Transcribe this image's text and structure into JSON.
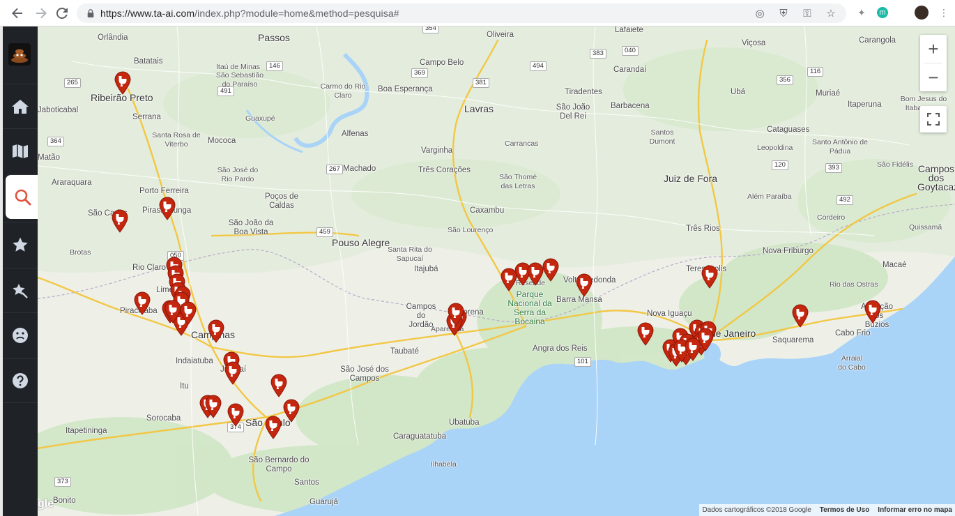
{
  "browser": {
    "url_host": "https://www.ta-ai.com",
    "url_path": "/index.php?module=home&method=pesquisa#",
    "extension_badge": "m"
  },
  "sidebar": {
    "items": [
      {
        "name": "home-icon"
      },
      {
        "name": "map-icon"
      },
      {
        "name": "search-icon"
      },
      {
        "name": "star-icon"
      },
      {
        "name": "pin-star-icon"
      },
      {
        "name": "sad-face-icon"
      },
      {
        "name": "help-icon"
      }
    ],
    "expand_label": "+"
  },
  "map": {
    "colors": {
      "land": "#eef0e8",
      "green": "#cde7c4",
      "water": "#a9d4f7",
      "road": "#f7d96a",
      "pin": "#c4260e"
    },
    "places": [
      "Orlândia",
      "Passos",
      "Lafaiete",
      "Oliveira",
      "Viçosa",
      "Carangola",
      "Batatais",
      "Itaú de Minas",
      "São Sebastião do Paraíso",
      "Campo Belo",
      "Carandaí",
      "Ribeirão Preto",
      "Carmo do Rio Claro",
      "Boa Esperança",
      "Tiradentes",
      "Ubá",
      "Muriaé",
      "Bom Jesus do Itabapoana",
      "Jaboticabal",
      "Serrana",
      "Lavras",
      "São João Del Rei",
      "Barbacena",
      "Itaperuna",
      "Guaxupé",
      "Santa Rosa de Viterbo",
      "Mococa",
      "Alfenas",
      "Carrancas",
      "Santos Dumont",
      "Cataguases",
      "Santo Antônio de Pádua",
      "Matão",
      "Varginha",
      "Leopoldina",
      "Araraquara",
      "Machado",
      "Três Corações",
      "São Thomé das Letras",
      "Juiz de Fora",
      "São Fidélis",
      "Campos dos Goytacazes",
      "São José do Rio Pardo",
      "Porto Ferreira",
      "Poços de Caldas",
      "Caxambu",
      "Além Paraíba",
      "Pirassununga",
      "São Carlos",
      "São João da Boa Vista",
      "Cordeiro",
      "Quissamã",
      "Três Rios",
      "São Lourenço",
      "Pouso Alegre",
      "Santa Rita do Sapucaí",
      "Nova Friburgo",
      "Brotas",
      "Rio Claro",
      "Itajubá",
      "Resende",
      "Volta Redonda",
      "Teresópolis",
      "Macaé",
      "Limeira",
      "Parque Nacional da Serra da Bocaina",
      "Barra Mansa",
      "Rio das Ostras",
      "Piracicaba",
      "Campos do Jordão",
      "Aparecida",
      "Lorena",
      "Armação dos Búzios",
      "Nova Iguaçu",
      "Campinas",
      "Rio de Janeiro",
      "Saquarema",
      "Cabo Frio",
      "Angra dos Reis",
      "Taubaté",
      "Indaiatuba",
      "Jundiaí",
      "Arraial do Cabo",
      "São José dos Campos",
      "Itu",
      "Sorocaba",
      "São Paulo",
      "Caraguatatuba",
      "Ubatuba",
      "Itapetininga",
      "Ilhabela",
      "São Bernardo do Campo",
      "Santos",
      "Bonito",
      "Guarujá"
    ],
    "highways": [
      "354",
      "383",
      "040",
      "116",
      "265",
      "491",
      "146",
      "369",
      "381",
      "494",
      "356",
      "364",
      "267",
      "120",
      "393",
      "459",
      "050",
      "101",
      "492",
      "373",
      "374"
    ],
    "markers_count": 47
  },
  "controls": {
    "zoom_in": "+",
    "zoom_out": "−"
  },
  "attribution": {
    "data": "Dados cartográficos ©2018 Google",
    "terms": "Termos de Uso",
    "report": "Informar erro no mapa"
  },
  "google_logo": "gle"
}
